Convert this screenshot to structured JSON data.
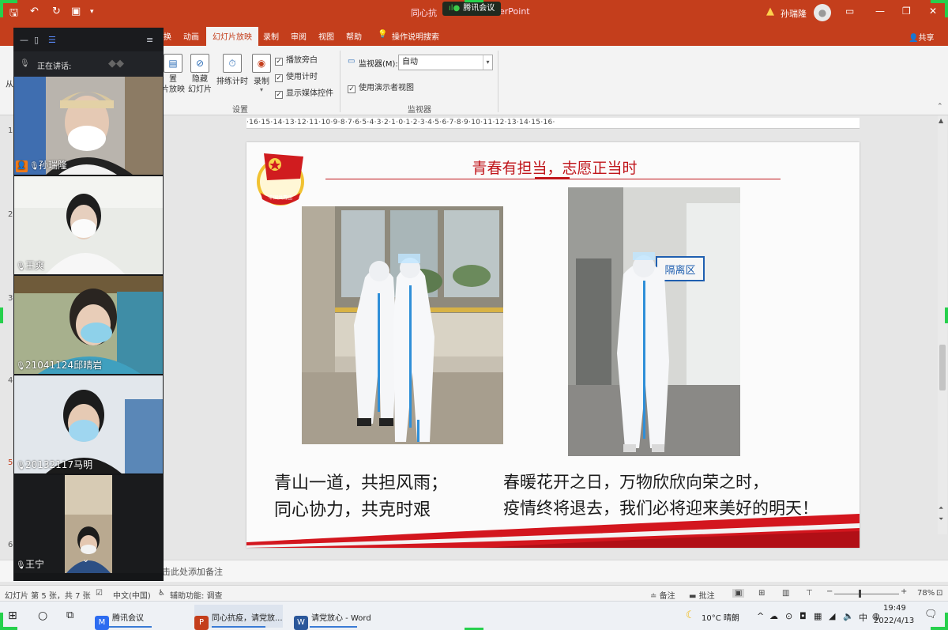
{
  "window": {
    "title_left": "同心抗",
    "title_right": "erPoint",
    "meeting_chip": "腾讯会议",
    "user": "孙瑞隆",
    "share_label": "共享"
  },
  "ribbon": {
    "tabs": [
      "换",
      "动画",
      "幻灯片放映",
      "录制",
      "审阅",
      "视图",
      "帮助",
      "操作说明搜索"
    ],
    "active_tab": "幻灯片放映",
    "buttons": {
      "setup_show": "置\n片放映",
      "hide_slide": "隐藏\n幻灯片",
      "rehearse": "排练计时",
      "record": "录制"
    },
    "checkboxes": [
      "播放旁白",
      "使用计时",
      "显示媒体控件"
    ],
    "group_setup": "设置",
    "monitor_label": "监视器(M):",
    "monitor_value": "自动",
    "presenter_view": "使用演示者视图",
    "group_monitor": "监视器"
  },
  "ruler": "·16·15·14·13·12·11·10·9·8·7·6·5·4·3·2·1·0·1·2·3·4·5·6·7·8·9·10·11·12·13·14·15·16·",
  "slide": {
    "title": "青春有担当，志愿正当时",
    "left_text": [
      "青山一道，共担风雨；",
      "同心协力，共克时艰"
    ],
    "right_text": [
      "春暖花开之日，万物欣欣向荣之时，",
      "疫情终将退去，我们必将迎来美好的明天！"
    ],
    "sign_text": "隔离区",
    "emblem_text": "中国共青团"
  },
  "left_pane_fragments": [
    "从",
    "1",
    "2",
    "3",
    "4",
    "5",
    "6"
  ],
  "notes_placeholder": "击此处添加备注",
  "status": {
    "slide_info": "幻灯片 第 5 张，共 7 张",
    "language": "中文(中国)",
    "accessibility": "辅助功能: 调查",
    "notes": "备注",
    "comments": "批注",
    "zoom": "78%"
  },
  "meeting": {
    "speaking_label": "正在讲话:",
    "participants": [
      {
        "name": "孙瑞隆",
        "host": true
      },
      {
        "name": "王爽",
        "host": false
      },
      {
        "name": "21041124邱晴岩",
        "host": false
      },
      {
        "name": "20132117马明",
        "host": false
      },
      {
        "name": "王宁",
        "host": false
      }
    ]
  },
  "taskbar": {
    "apps": [
      "腾讯会议",
      "同心抗疫，请党放...",
      "请党放心 - Word"
    ],
    "weather": "10°C 晴朗",
    "ime": "中",
    "time": "19:49",
    "date": "2022/4/13"
  },
  "colors": {
    "ppt_accent": "#c43e1c",
    "slide_red": "#c0151b",
    "frame_green": "#26d04c"
  }
}
